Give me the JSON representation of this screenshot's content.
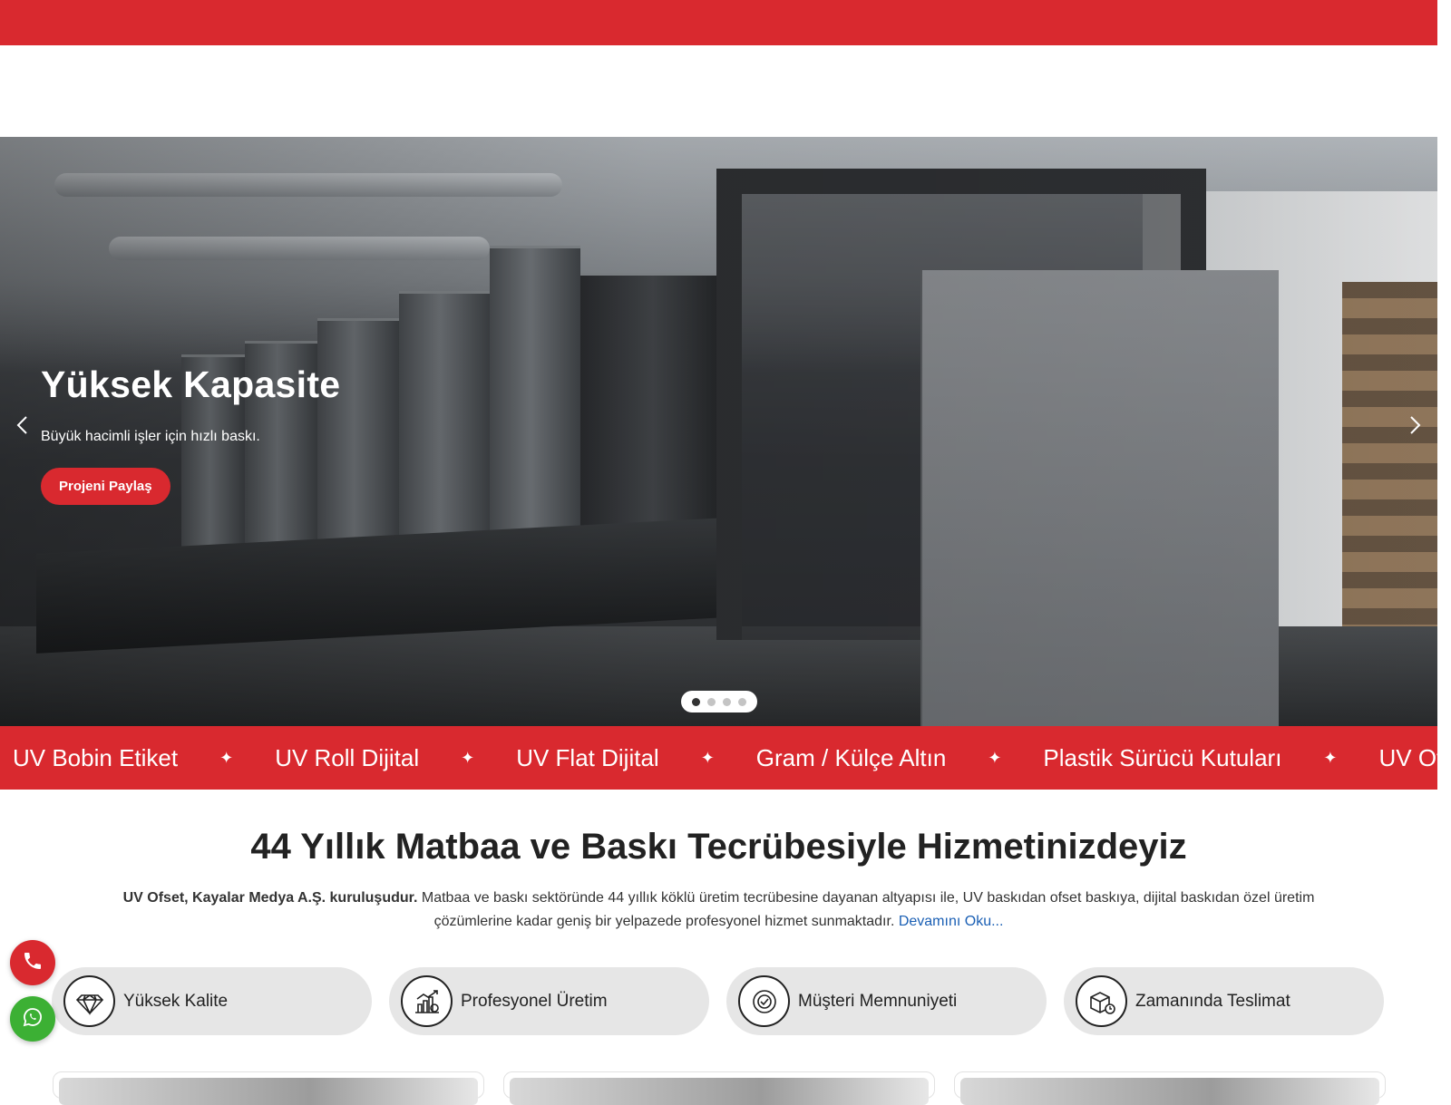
{
  "hero": {
    "title": "Yüksek Kapasite",
    "subtitle": "Büyük hacimli işler için hızlı baskı.",
    "cta_label": "Projeni Paylaş",
    "slide_count": 4,
    "active_slide": 1
  },
  "ticker": {
    "items": [
      "UV Bobin Etiket",
      "UV Roll Dijital",
      "UV Flat Dijital",
      "Gram / Külçe Altın",
      "Plastik Sürücü Kutuları",
      "UV Ofset"
    ],
    "separator": "✦"
  },
  "about": {
    "headline": "44 Yıllık Matbaa ve Baskı Tecrübesiyle Hizmetinizdeyiz",
    "intro_bold": "UV Ofset, Kayalar Medya A.Ş. kuruluşudur.",
    "intro_text": " Matbaa ve baskı sektöründe 44 yıllık köklü üretim tecrübesine dayanan altyapısı ile, UV baskıdan ofset baskıya, dijital baskıdan özel üretim çözümlerine kadar geniş bir yelpazede profesyonel hizmet sunmaktadır. ",
    "read_more": "Devamını Oku..."
  },
  "features": [
    {
      "label": "Yüksek Kalite",
      "icon": "diamond-icon"
    },
    {
      "label": "Profesyonel Üretim",
      "icon": "factory-chart-icon"
    },
    {
      "label": "Müşteri Memnuniyeti",
      "icon": "badge-icon"
    },
    {
      "label": "Zamanında Teslimat",
      "icon": "delivery-box-icon"
    }
  ],
  "floating": {
    "phone_icon": "phone-icon",
    "whatsapp_icon": "whatsapp-icon"
  },
  "colors": {
    "brand_red": "#d9292f",
    "whatsapp_green": "#3cb034",
    "link_blue": "#1a5fb4",
    "feature_bg": "#e6e6e6"
  }
}
